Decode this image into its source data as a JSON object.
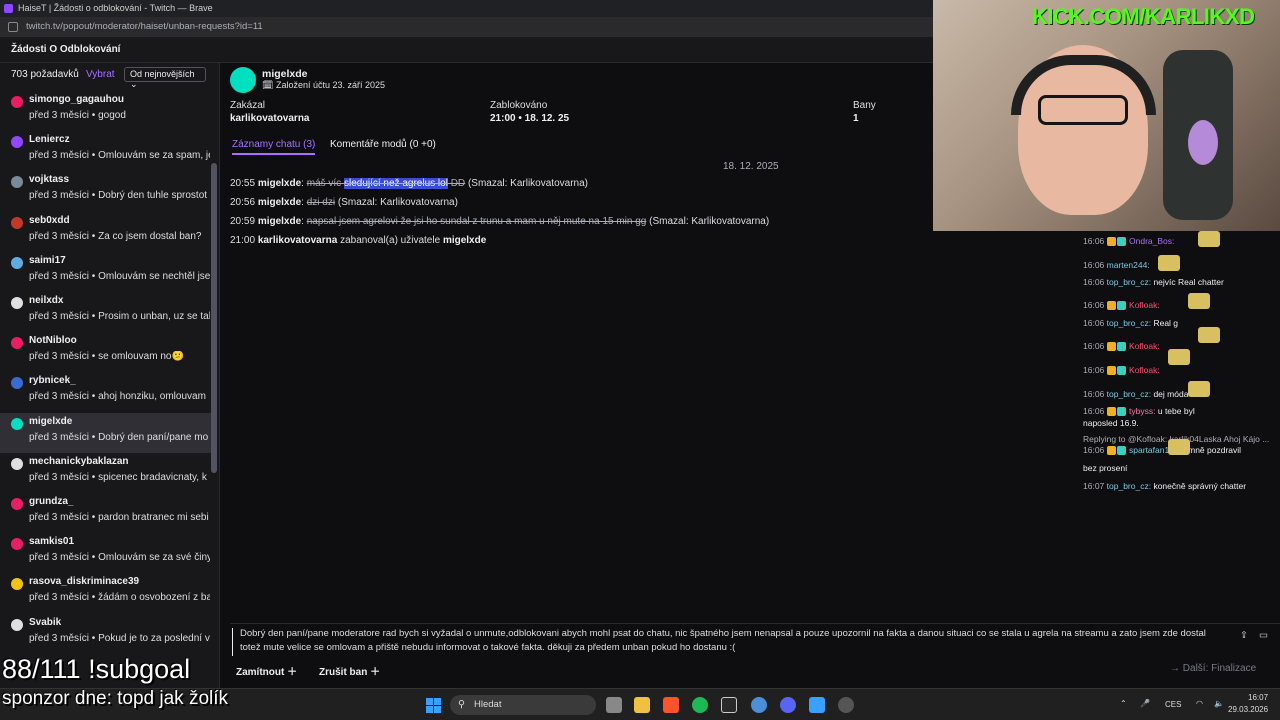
{
  "window": {
    "title": "HaiseT | Žádosti o odblokování - Twitch — Brave",
    "url": "twitch.tv/popout/moderator/haiset/unban-requests?id=11"
  },
  "header": {
    "title": "Žádosti O Odblokování"
  },
  "sidebar": {
    "count": "703 požadavků",
    "select_label": "Vybrat",
    "sort": "Od nejnovějších",
    "items": [
      {
        "name": "simongo_gagauhou",
        "msg": "před 3 měsíci • gogod",
        "color": "#e91e63"
      },
      {
        "name": "Leniercz",
        "msg": "před 3 měsíci • Omlouvám se za spam, je",
        "color": "#9147ff"
      },
      {
        "name": "vojktass",
        "msg": "před 3 měsíci • Dobrý den tuhle sprostot",
        "color": "#7a8a99"
      },
      {
        "name": "seb0xdd",
        "msg": "před 3 měsíci • Za co jsem dostal ban?",
        "color": "#c0392b"
      },
      {
        "name": "saimi17",
        "msg": "před 3 měsíci • Omlouvám se nechtěl jse",
        "color": "#5dade2"
      },
      {
        "name": "neilxdx",
        "msg": "před 3 měsíci • Prosim o unban, uz se tal",
        "color": "#dedee3"
      },
      {
        "name": "NotNibloo",
        "msg": "před 3 měsíci • se omlouvam no😕",
        "color": "#e91e63"
      },
      {
        "name": "rybnicek_",
        "msg": "před 3 měsíci • ahoj honziku, omlouvam",
        "color": "#3a6bd4"
      },
      {
        "name": "migelxde",
        "msg": "před 3 měsíci • Dobrý den paní/pane mo",
        "color": "#00e0c0"
      },
      {
        "name": "mechanickybaklazan",
        "msg": "před 3 měsíci • spicenec bradavicnaty, k",
        "color": "#dedee3"
      },
      {
        "name": "grundza_",
        "msg": "před 3 měsíci • pardon bratranec mi sebi",
        "color": "#e91e63"
      },
      {
        "name": "samkis01",
        "msg": "před 3 měsíci • Omlouvám se za své činy",
        "color": "#e91e63"
      },
      {
        "name": "rasova_diskriminace39",
        "msg": "před 3 měsíci • žádám o osvobození z ba",
        "color": "#f1c40f"
      },
      {
        "name": "Svabik",
        "msg": "před 3 měsíci • Pokud je to za poslední v",
        "color": "#dedee3"
      }
    ]
  },
  "detail": {
    "username": "migelxde",
    "created": "Založení účtu 23. září 2025",
    "banned_by_label": "Zakázal",
    "banned_by": "karlikovatovarna",
    "blocked_label": "Zablokováno",
    "blocked": "21:00 • 18. 12. 25",
    "bans_label": "Bany",
    "bans": "1",
    "tabs": [
      "Záznamy chatu (3)",
      "Komentáře modů (0 +0)"
    ],
    "date": "18. 12. 2025",
    "log": [
      {
        "time": "20:55",
        "user": "migelxde",
        "pre": "máš víc ",
        "hl": "sledující než agrelus lol",
        "post": " DD",
        "note": "(Smazal: Karlikovatovarna)"
      },
      {
        "time": "20:56",
        "user": "migelxde",
        "pre": "dzi dzi",
        "hl": "",
        "post": "",
        "note": "(Smazal: Karlikovatovarna)"
      },
      {
        "time": "20:59",
        "user": "migelxde",
        "pre": "napsal jsem agrelovi že jsi ho sundal z trunu a mam u něj mute na 15 min gg",
        "hl": "",
        "post": "",
        "note": "(Smazal: Karlikovatovarna)"
      }
    ],
    "ban_line": {
      "time": "21:00",
      "mod": "karlikovatovarna",
      "text": "zabanoval(a) uživatele",
      "user": "migelxde"
    },
    "appeal": "Dobrý den paní/pane moderatore rad bych si vyžadal o unmute,odblokovani abych mohl psat do chatu, nic špatného jsem nenapsal a pouze upozornil na fakta a danou situaci co se stala u agrela na streamu a zato jsem zde dostal totež mute velice se omlovam a přiště nebudu informovat o takové fakta. děkuji za předem unban pokud ho dostanu :(",
    "deny": "Zamítnout",
    "cancel_ban": "Zrušit ban",
    "next": "Další: Finalizace"
  },
  "stream": {
    "kick": "KICK.COM/KARLIKXD",
    "chat": [
      {
        "time": "16:06",
        "user": "Ondra_Bos:",
        "color": "#a970ff",
        "text": ""
      },
      {
        "time": "16:06",
        "user": "marten244:",
        "color": "#7ec8e3",
        "text": ""
      },
      {
        "time": "16:06",
        "user": "top_bro_cz:",
        "color": "#7ec8e3",
        "text": "nejvíc Real chatter"
      },
      {
        "time": "16:06",
        "user": "Kofloak:",
        "color": "#ff4d6d",
        "text": ""
      },
      {
        "time": "16:06",
        "user": "top_bro_cz:",
        "color": "#7ec8e3",
        "text": "Real g"
      },
      {
        "time": "16:06",
        "user": "Kofloak:",
        "color": "#ff4d6d",
        "text": ""
      },
      {
        "time": "16:06",
        "user": "Kofloak:",
        "color": "#ff4d6d",
        "text": ""
      },
      {
        "time": "16:06",
        "user": "top_bro_cz:",
        "color": "#7ec8e3",
        "text": "dej     móda"
      },
      {
        "time": "16:06",
        "user": "tybyss:",
        "color": "#ff6fa3",
        "text": "u tebe byl"
      },
      {
        "time": "",
        "user": "",
        "color": "#efeff1",
        "text": "naposled 16.9."
      },
      {
        "time": "",
        "user": "",
        "color": "#adadb8",
        "text": "Replying to @Kofloak: karlik04Laska Ahoj Kájo ..."
      },
      {
        "time": "16:06",
        "user": "spartafan1893:",
        "color": "#7ec8e3",
        "text": "mně pozdravil"
      },
      {
        "time": "",
        "user": "",
        "color": "#efeff1",
        "text": "bez prosení"
      },
      {
        "time": "16:07",
        "user": "top_bro_cz:",
        "color": "#7ec8e3",
        "text": "konečně správný chatter"
      }
    ],
    "subgoal": "88/111 !subgoal",
    "sponsor": "sponzor dne: topd jak žolík"
  },
  "taskbar": {
    "search": "Hledat",
    "lang": "CES",
    "time": "16:07",
    "date": "29.03.2026"
  }
}
